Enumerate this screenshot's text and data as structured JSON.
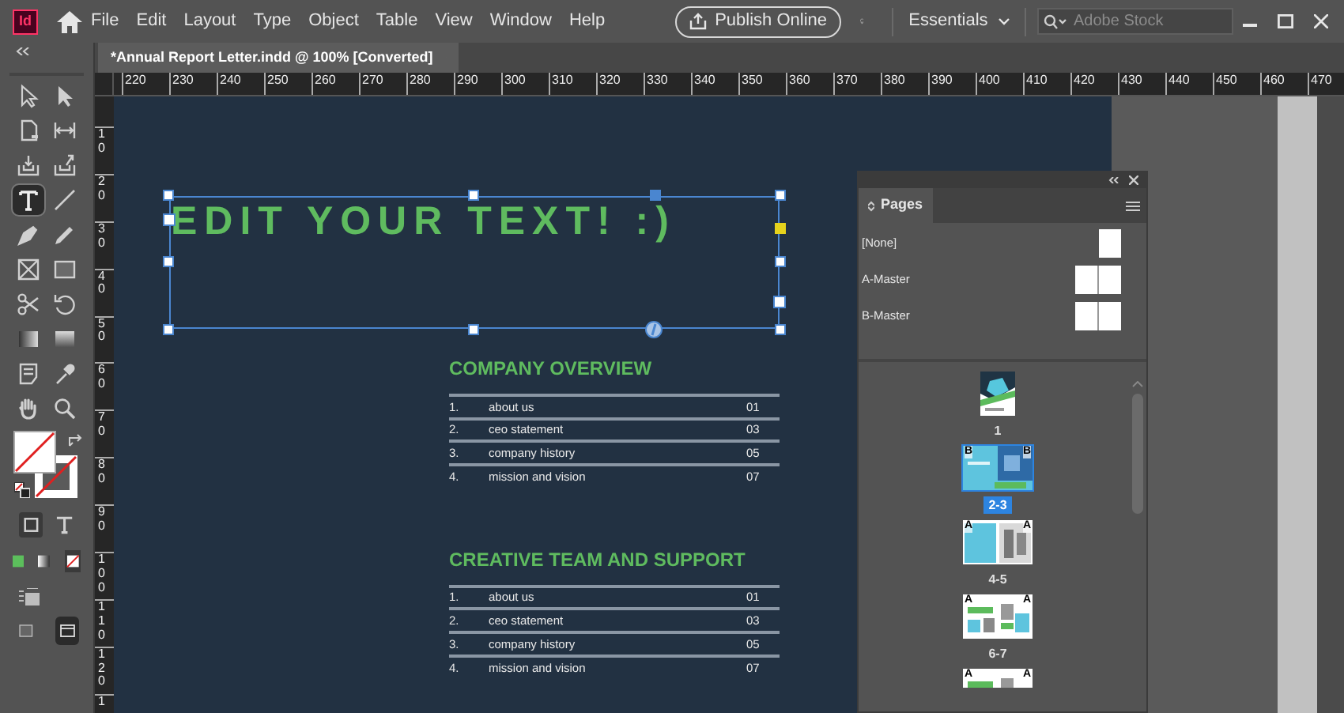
{
  "app_logo": "Id",
  "menu": [
    "File",
    "Edit",
    "Layout",
    "Type",
    "Object",
    "Table",
    "View",
    "Window",
    "Help"
  ],
  "publish_button": "Publish Online",
  "workspace": "Essentials",
  "search": {
    "placeholder": "Adobe Stock"
  },
  "document_tab": {
    "title": "*Annual Report Letter.indd @ 100% [Converted]",
    "selected": true
  },
  "ruler": {
    "horizontal": [
      "220",
      "230",
      "240",
      "250",
      "260",
      "270",
      "280",
      "290",
      "300",
      "310",
      "320",
      "330",
      "340",
      "350",
      "360",
      "370",
      "380",
      "390",
      "400",
      "410",
      "420",
      "430",
      "440",
      "450",
      "460",
      "470"
    ],
    "vertical": [
      "10",
      "20",
      "30",
      "40",
      "50",
      "60",
      "70",
      "80",
      "90",
      "100",
      "110",
      "120",
      "1"
    ]
  },
  "tools": [
    {
      "kind": "direct-selection",
      "selected": false
    },
    {
      "kind": "selection",
      "selected": false
    },
    {
      "kind": "page",
      "selected": false
    },
    {
      "kind": "gap",
      "selected": false
    },
    {
      "kind": "collector",
      "selected": false
    },
    {
      "kind": "placer",
      "selected": false
    },
    {
      "kind": "type",
      "selected": true
    },
    {
      "kind": "line",
      "selected": false
    },
    {
      "kind": "pen",
      "selected": false
    },
    {
      "kind": "pencil",
      "selected": false
    },
    {
      "kind": "frame",
      "selected": false
    },
    {
      "kind": "rectangle",
      "selected": false
    },
    {
      "kind": "scissors",
      "selected": false
    },
    {
      "kind": "rotate",
      "selected": false
    },
    {
      "kind": "gradient",
      "selected": false
    },
    {
      "kind": "feather",
      "selected": false
    },
    {
      "kind": "note",
      "selected": false
    },
    {
      "kind": "eyedropper",
      "selected": false
    },
    {
      "kind": "hand",
      "selected": false
    },
    {
      "kind": "zoom",
      "selected": false
    }
  ],
  "view_modes": [
    {
      "selected": false
    },
    {
      "selected": true
    }
  ],
  "text_frame": {
    "text": "EDIT YOUR TEXT! :)"
  },
  "sections": [
    {
      "title": "COMPANY OVERVIEW",
      "rows": [
        {
          "number": "1.",
          "label": "about us",
          "page": "01"
        },
        {
          "number": "2.",
          "label": "ceo statement",
          "page": "03"
        },
        {
          "number": "3.",
          "label": "company history",
          "page": "05"
        },
        {
          "number": "4.",
          "label": "mission and vision",
          "page": "07"
        }
      ]
    },
    {
      "title": "CREATIVE TEAM AND SUPPORT",
      "rows": [
        {
          "number": "1.",
          "label": "about us",
          "page": "01"
        },
        {
          "number": "2.",
          "label": "ceo statement",
          "page": "03"
        },
        {
          "number": "3.",
          "label": "company history",
          "page": "05"
        },
        {
          "number": "4.",
          "label": "mission and vision",
          "page": "07"
        }
      ]
    }
  ],
  "pages_panel": {
    "title": "Pages",
    "masters": [
      {
        "name": "[None]",
        "kind": "single"
      },
      {
        "name": "A-Master",
        "kind": "double"
      },
      {
        "name": "B-Master",
        "kind": "double"
      }
    ],
    "spreads": [
      {
        "kind": "single",
        "label": "1",
        "selected": false
      },
      {
        "kind": "double",
        "label": "2-3",
        "masters": [
          "B",
          "B"
        ],
        "selected": true
      },
      {
        "kind": "double",
        "label": "4-5",
        "masters": [
          "A",
          "A"
        ],
        "selected": false
      },
      {
        "kind": "double",
        "label": "6-7",
        "masters": [
          "A",
          "A"
        ],
        "selected": false
      },
      {
        "kind": "partial",
        "masters": [
          "A",
          "A"
        ],
        "selected": false
      }
    ]
  }
}
